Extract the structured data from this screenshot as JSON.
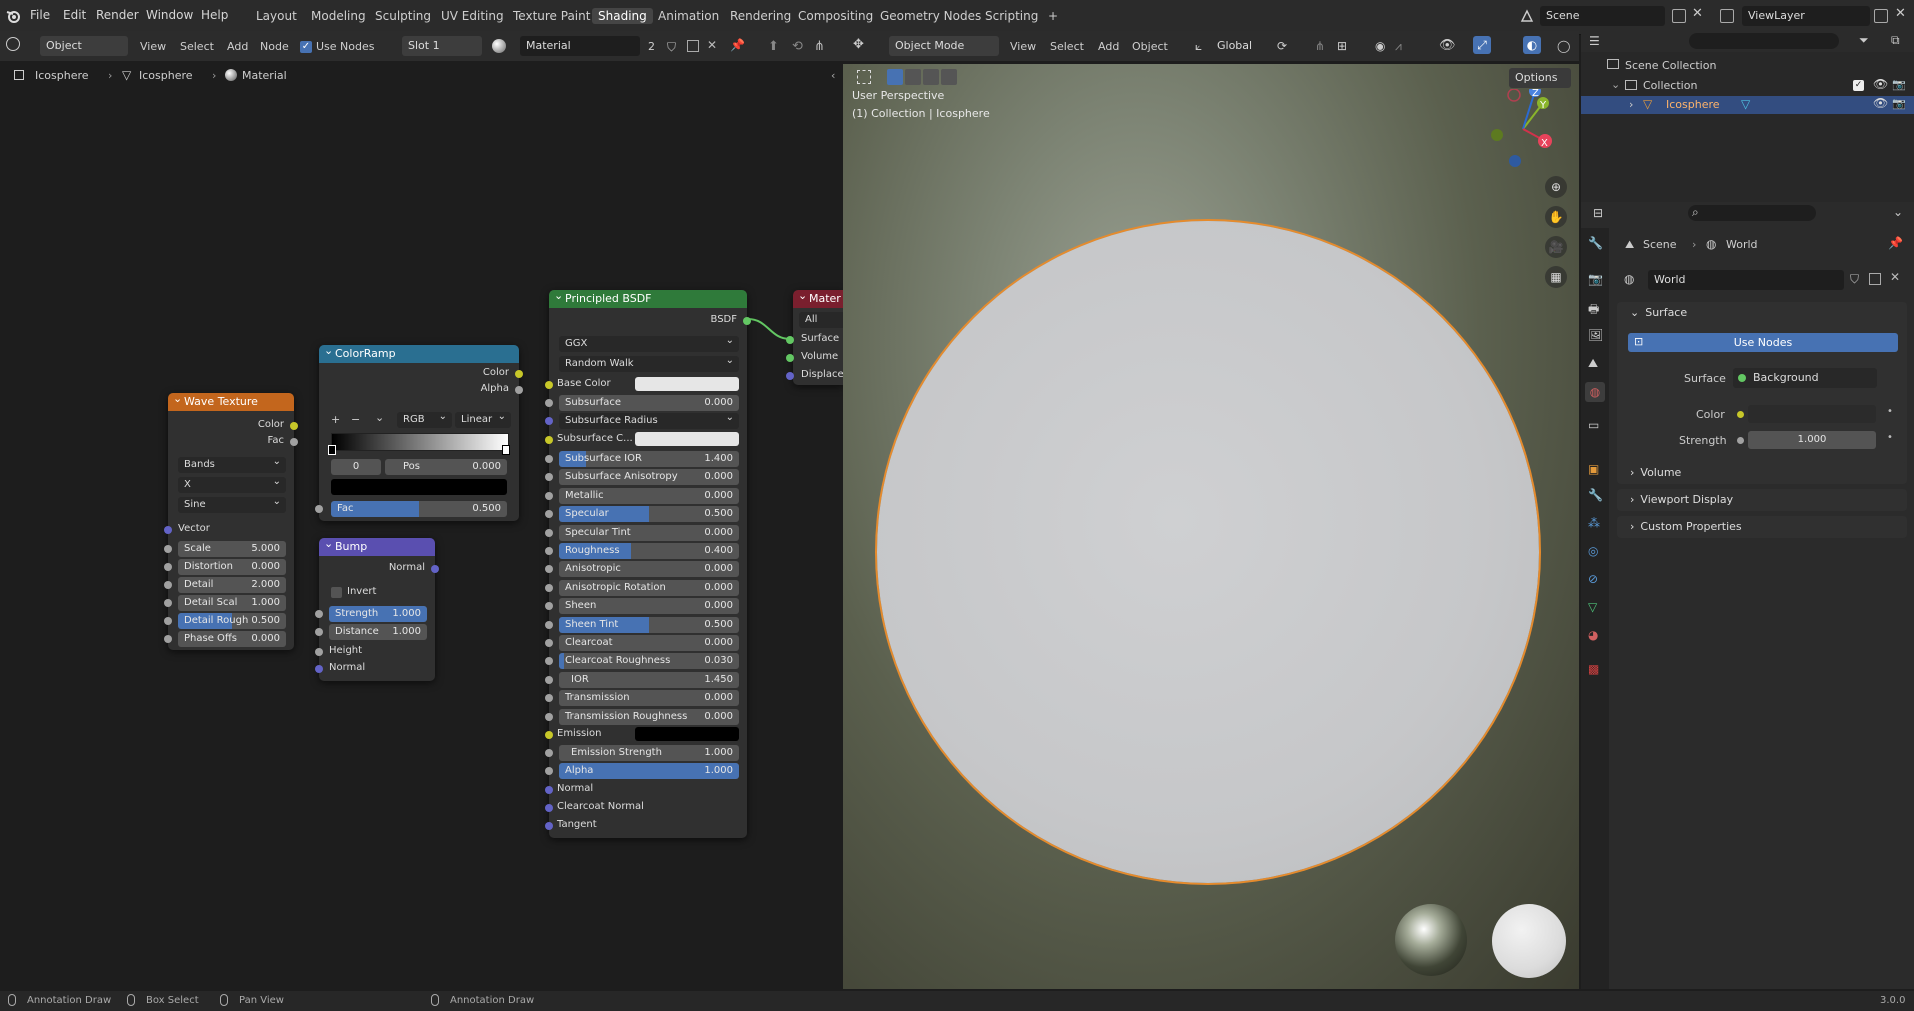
{
  "topbar": {
    "menus": [
      "File",
      "Edit",
      "Render",
      "Window",
      "Help"
    ],
    "workspaces": [
      "Layout",
      "Modeling",
      "Sculpting",
      "UV Editing",
      "Texture Paint",
      "Shading",
      "Animation",
      "Rendering",
      "Compositing",
      "Geometry Nodes",
      "Scripting"
    ],
    "active_workspace": "Shading",
    "add_tab": "+",
    "scene_label": "Scene",
    "viewlayer_label": "ViewLayer"
  },
  "node_editor": {
    "header": {
      "mode": "Object",
      "view": "View",
      "select": "Select",
      "add": "Add",
      "node": "Node",
      "use_nodes": "Use Nodes",
      "slot": "Slot 1",
      "material": "Material",
      "users": "2"
    },
    "breadcrumb": [
      "Icosphere",
      "Icosphere",
      "Material"
    ],
    "wave_texture": {
      "title": "Wave Texture",
      "outputs": [
        "Color",
        "Fac"
      ],
      "dropdowns": [
        "Bands",
        "X",
        "Sine"
      ],
      "vector": "Vector",
      "fields": [
        {
          "label": "Scale",
          "value": "5.000"
        },
        {
          "label": "Distortion",
          "value": "0.000"
        },
        {
          "label": "Detail",
          "value": "2.000"
        },
        {
          "label": "Detail Scal",
          "value": "1.000"
        },
        {
          "label": "Detail Rough",
          "value": "0.500"
        },
        {
          "label": "Phase Offs",
          "value": "0.000"
        }
      ]
    },
    "color_ramp": {
      "title": "ColorRamp",
      "outputs": [
        "Color",
        "Alpha"
      ],
      "plus": "+",
      "minus": "−",
      "mode": "RGB",
      "interp": "Linear",
      "index": "0",
      "pos_label": "Pos",
      "pos_value": "0.000",
      "fac_label": "Fac",
      "fac_value": "0.500"
    },
    "bump": {
      "title": "Bump",
      "output": "Normal",
      "invert": "Invert",
      "strength_label": "Strength",
      "strength_value": "1.000",
      "distance_label": "Distance",
      "distance_value": "1.000",
      "height": "Height",
      "normal": "Normal"
    },
    "principled": {
      "title": "Principled BSDF",
      "output": "BSDF",
      "distribution": "GGX",
      "subsurface_method": "Random Walk",
      "base_color": "Base Color",
      "subsurface": {
        "label": "Subsurface",
        "value": "0.000"
      },
      "subsurface_radius": "Subsurface Radius",
      "subsurface_color": "Subsurface C...",
      "fields": [
        {
          "label": "Subsurface IOR",
          "value": "1.400",
          "fill": 0.15
        },
        {
          "label": "Subsurface Anisotropy",
          "value": "0.000",
          "fill": 0
        },
        {
          "label": "Metallic",
          "value": "0.000",
          "fill": 0
        },
        {
          "label": "Specular",
          "value": "0.500",
          "fill": 0.5
        },
        {
          "label": "Specular Tint",
          "value": "0.000",
          "fill": 0
        },
        {
          "label": "Roughness",
          "value": "0.400",
          "fill": 0.4
        },
        {
          "label": "Anisotropic",
          "value": "0.000",
          "fill": 0
        },
        {
          "label": "Anisotropic Rotation",
          "value": "0.000",
          "fill": 0
        },
        {
          "label": "Sheen",
          "value": "0.000",
          "fill": 0
        },
        {
          "label": "Sheen Tint",
          "value": "0.500",
          "fill": 0.5
        },
        {
          "label": "Clearcoat",
          "value": "0.000",
          "fill": 0
        },
        {
          "label": "Clearcoat Roughness",
          "value": "0.030",
          "fill": 0.03
        },
        {
          "label": "IOR",
          "value": "1.450",
          "fill": 0
        },
        {
          "label": "Transmission",
          "value": "0.000",
          "fill": 0
        },
        {
          "label": "Transmission Roughness",
          "value": "0.000",
          "fill": 0
        }
      ],
      "emission": "Emission",
      "emission_strength": {
        "label": "Emission Strength",
        "value": "1.000"
      },
      "alpha": {
        "label": "Alpha",
        "value": "1.000",
        "fill": 1
      },
      "normal": "Normal",
      "clearcoat_normal": "Clearcoat Normal",
      "tangent": "Tangent"
    },
    "material_output": {
      "title": "Mater",
      "target": "All",
      "inputs": [
        "Surface",
        "Volume",
        "Displace"
      ]
    }
  },
  "viewport": {
    "header": {
      "mode": "Object Mode",
      "view": "View",
      "select": "Select",
      "add": "Add",
      "object": "Object",
      "orientation": "Global",
      "options": "Options"
    },
    "info_line1": "User Perspective",
    "info_line2": "(1) Collection | Icosphere",
    "gizmo": {
      "x": "X",
      "y": "Y",
      "z": "Z"
    }
  },
  "outliner": {
    "scene_collection": "Scene Collection",
    "collection": "Collection",
    "object": "Icosphere"
  },
  "properties": {
    "breadcrumb": [
      "Scene",
      "World"
    ],
    "world_name": "World",
    "surface_panel": "Surface",
    "use_nodes": "Use Nodes",
    "surface_label": "Surface",
    "surface_value": "Background",
    "color_label": "Color",
    "strength_label": "Strength",
    "strength_value": "1.000",
    "panels": [
      "Volume",
      "Viewport Display",
      "Custom Properties"
    ]
  },
  "statusbar": {
    "items": [
      "Annotation Draw",
      "Box Select",
      "Pan View",
      "Annotation Draw"
    ],
    "version": "3.0.0"
  },
  "colors": {
    "accent": "#4772b3",
    "selection_outline": "#e58b2d",
    "shader_header": "#2f7a3a",
    "texture_header": "#c3661d",
    "converter_header": "#2a6f91",
    "vector_header": "#5a4fb0",
    "output_header": "#7a1f2e"
  }
}
